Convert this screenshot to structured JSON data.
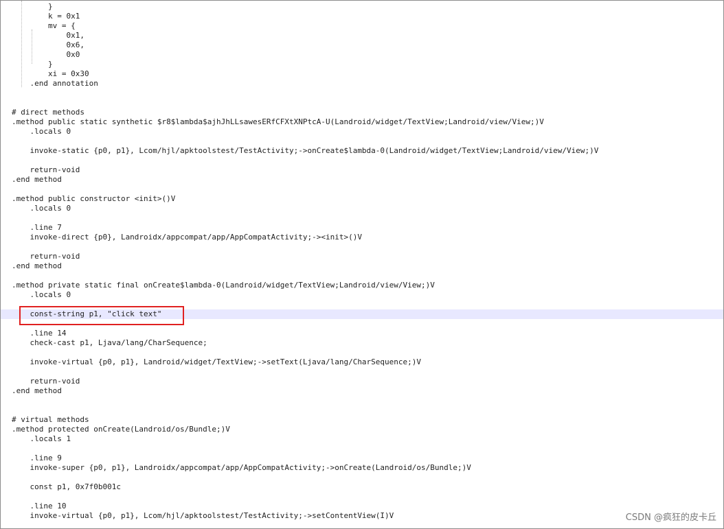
{
  "editor": {
    "lines": [
      "        }",
      "        k = 0x1",
      "        mv = {",
      "            0x1,",
      "            0x6,",
      "            0x0",
      "        }",
      "        xi = 0x30",
      "    .end annotation",
      "",
      "",
      "# direct methods",
      ".method public static synthetic $r8$lambda$ajhJhLLsawesERfCFXtXNPtcA-U(Landroid/widget/TextView;Landroid/view/View;)V",
      "    .locals 0",
      "",
      "    invoke-static {p0, p1}, Lcom/hjl/apktoolstest/TestActivity;->onCreate$lambda-0(Landroid/widget/TextView;Landroid/view/View;)V",
      "",
      "    return-void",
      ".end method",
      "",
      ".method public constructor <init>()V",
      "    .locals 0",
      "",
      "    .line 7",
      "    invoke-direct {p0}, Landroidx/appcompat/app/AppCompatActivity;-><init>()V",
      "",
      "    return-void",
      ".end method",
      "",
      ".method private static final onCreate$lambda-0(Landroid/widget/TextView;Landroid/view/View;)V",
      "    .locals 0",
      "",
      "    const-string p1, \"click text\"",
      "",
      "    .line 14",
      "    check-cast p1, Ljava/lang/CharSequence;",
      "",
      "    invoke-virtual {p0, p1}, Landroid/widget/TextView;->setText(Ljava/lang/CharSequence;)V",
      "",
      "    return-void",
      ".end method",
      "",
      "",
      "# virtual methods",
      ".method protected onCreate(Landroid/os/Bundle;)V",
      "    .locals 1",
      "",
      "    .line 9",
      "    invoke-super {p0, p1}, Landroidx/appcompat/app/AppCompatActivity;->onCreate(Landroid/os/Bundle;)V",
      "",
      "    const p1, 0x7f0b001c",
      "",
      "    .line 10",
      "    invoke-virtual {p0, p1}, Lcom/hjl/apktoolstest/TestActivity;->setContentView(I)V"
    ],
    "highlighted_line": 32
  },
  "annotation_color": "#e02020",
  "highlight_color": "#e8e8ff",
  "watermark": "CSDN @疯狂的皮卡丘"
}
